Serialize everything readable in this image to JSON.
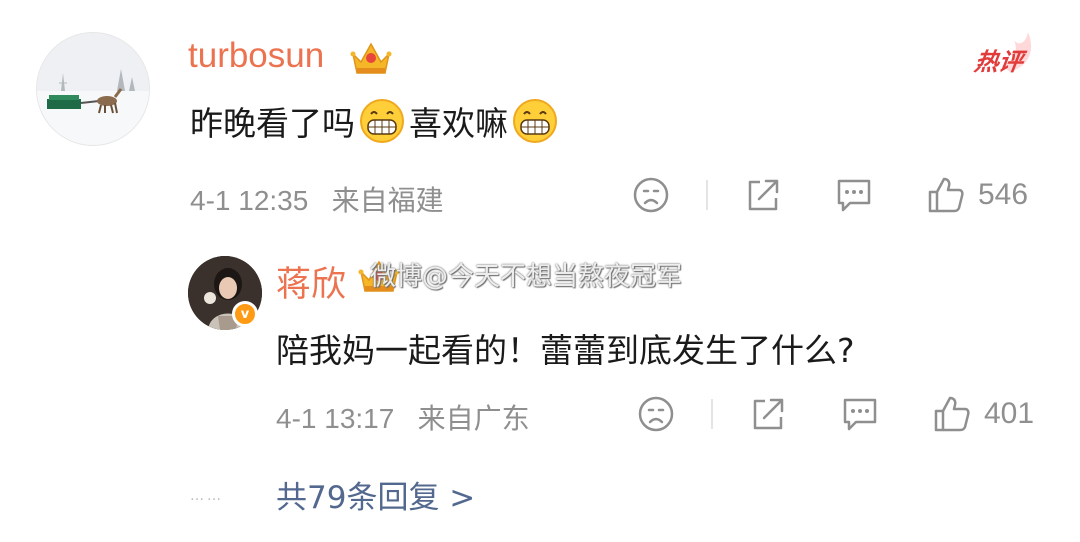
{
  "main_comment": {
    "username": "turbosun",
    "text_part1": "昨晚看了吗",
    "text_part2": "喜欢嘛",
    "timestamp": "4-1 12:35",
    "location": "来自福建",
    "like_count": "546",
    "badge": "热评"
  },
  "reply": {
    "username": "蒋欣",
    "text": "陪我妈一起看的！蕾蕾到底发生了什么?",
    "timestamp": "4-1 13:17",
    "location": "来自广东",
    "like_count": "401",
    "verified_mark": "v"
  },
  "watermark": "微博@今天不想当熬夜冠军",
  "more_dots": "……",
  "more_replies": "共79条回复 >",
  "colors": {
    "username": "#eb7350",
    "meta": "#8f8f8f",
    "link": "#53688f",
    "hot_badge": "#e23b3b"
  },
  "icons": [
    "crown-icon",
    "grin-emoji-icon",
    "dislike-face-icon",
    "repost-icon",
    "comment-icon",
    "like-thumb-icon",
    "verified-icon"
  ]
}
